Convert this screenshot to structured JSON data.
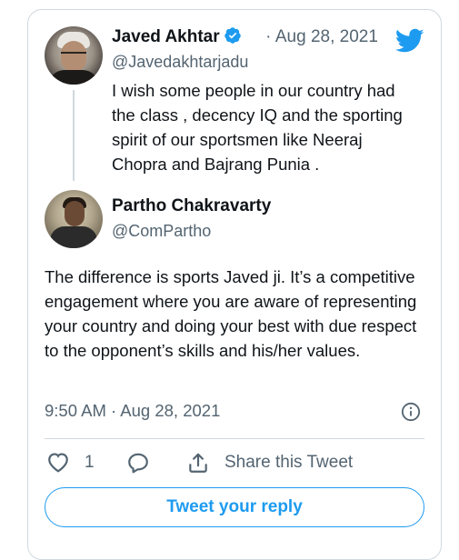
{
  "original_tweet": {
    "author_name": "Javed Akhtar",
    "separator": "·",
    "date": "Aug 28, 2021",
    "handle": "@Javedakhtarjadu",
    "text": "I wish some people in our country had the class , decency IQ and the sporting spirit of our sportsmen like Neeraj Chopra and Bajrang Punia ."
  },
  "reply_tweet": {
    "author_name": "Partho Chakravarty",
    "handle": "@ComPartho",
    "text": "The difference is sports Javed ji. It’s a competitive engagement where you are aware of representing your country and doing your best with due respect to the opponent’s skills and his/her values.",
    "timestamp": "9:50 AM · Aug 28, 2021"
  },
  "actions": {
    "like_count": "1",
    "share_label": "Share this Tweet",
    "reply_button_label": "Tweet your reply"
  },
  "colors": {
    "accent": "#1d9bf0",
    "text_primary": "#0f1419",
    "text_secondary": "#536471",
    "border": "#cfd9de"
  },
  "icons": [
    "verified-badge-icon",
    "twitter-bird-icon",
    "info-icon",
    "heart-icon",
    "reply-icon",
    "share-icon"
  ]
}
